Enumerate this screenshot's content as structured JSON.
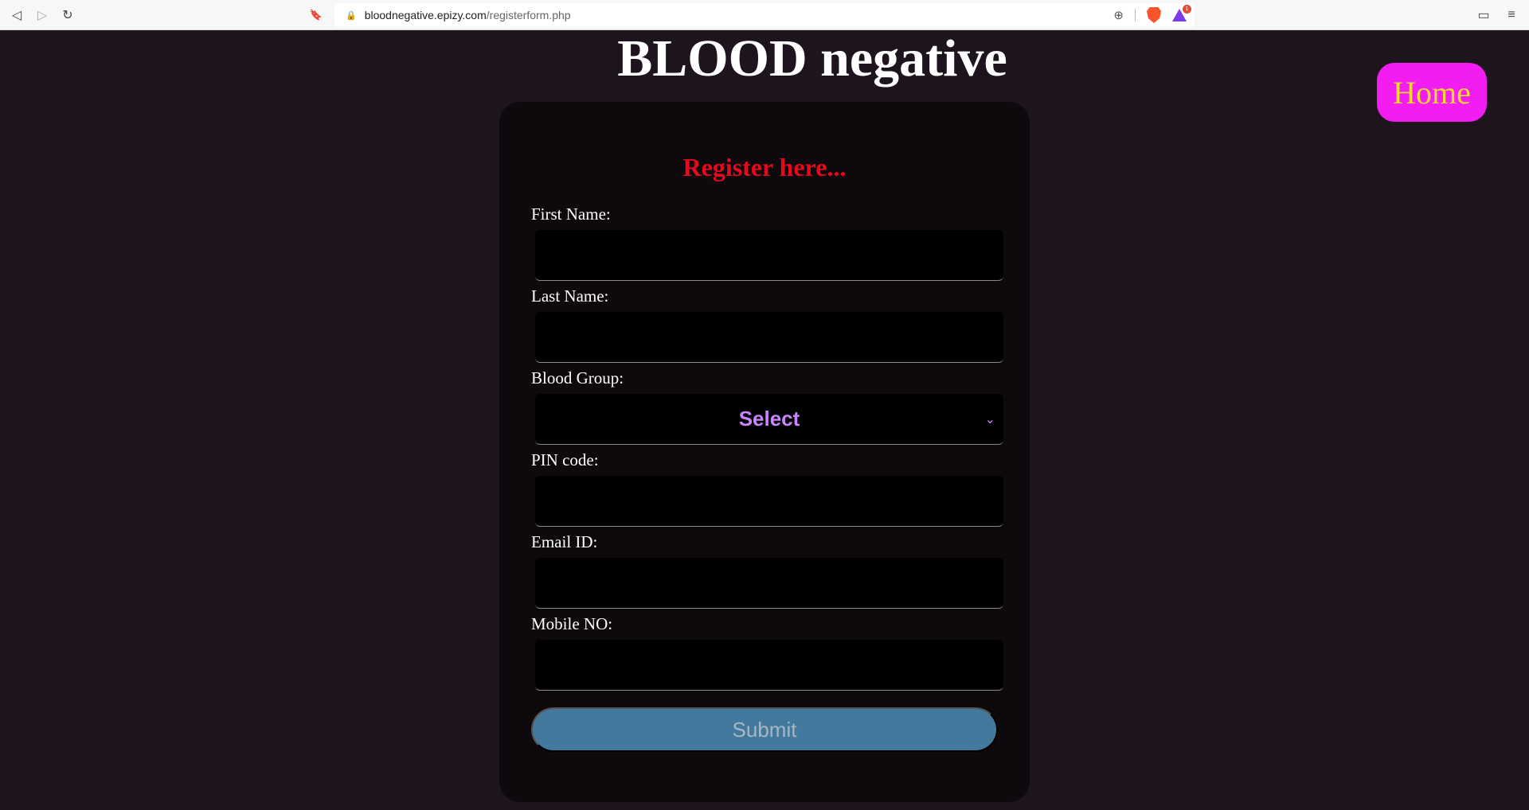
{
  "browser": {
    "url_domain": "bloodnegative.epizy.com",
    "url_path": "/registerform.php",
    "back_icon": "◁",
    "forward_icon": "▷",
    "reload_icon": "↻",
    "bookmark_icon": "🔖",
    "zoom_icon": "⊕",
    "wallet_icon": "▭",
    "menu_icon": "≡",
    "rewards_badge": "1"
  },
  "page": {
    "title": "BLOOD negative",
    "home_label": "Home"
  },
  "form": {
    "heading": "Register here...",
    "fields": [
      {
        "label": "First Name:",
        "value": ""
      },
      {
        "label": "Last Name:",
        "value": ""
      },
      {
        "label": "Blood Group:",
        "value": "Select"
      },
      {
        "label": "PIN code:",
        "value": ""
      },
      {
        "label": "Email ID:",
        "value": ""
      },
      {
        "label": "Mobile NO:",
        "value": ""
      }
    ],
    "submit_label": "Submit"
  },
  "colors": {
    "background": "#1e141e",
    "card": "#0d090d",
    "heading": "#e8081c",
    "home_bg": "#f21df2",
    "home_text": "#f0d830",
    "select_text": "#c884ff",
    "submit_bg": "#44799e"
  }
}
